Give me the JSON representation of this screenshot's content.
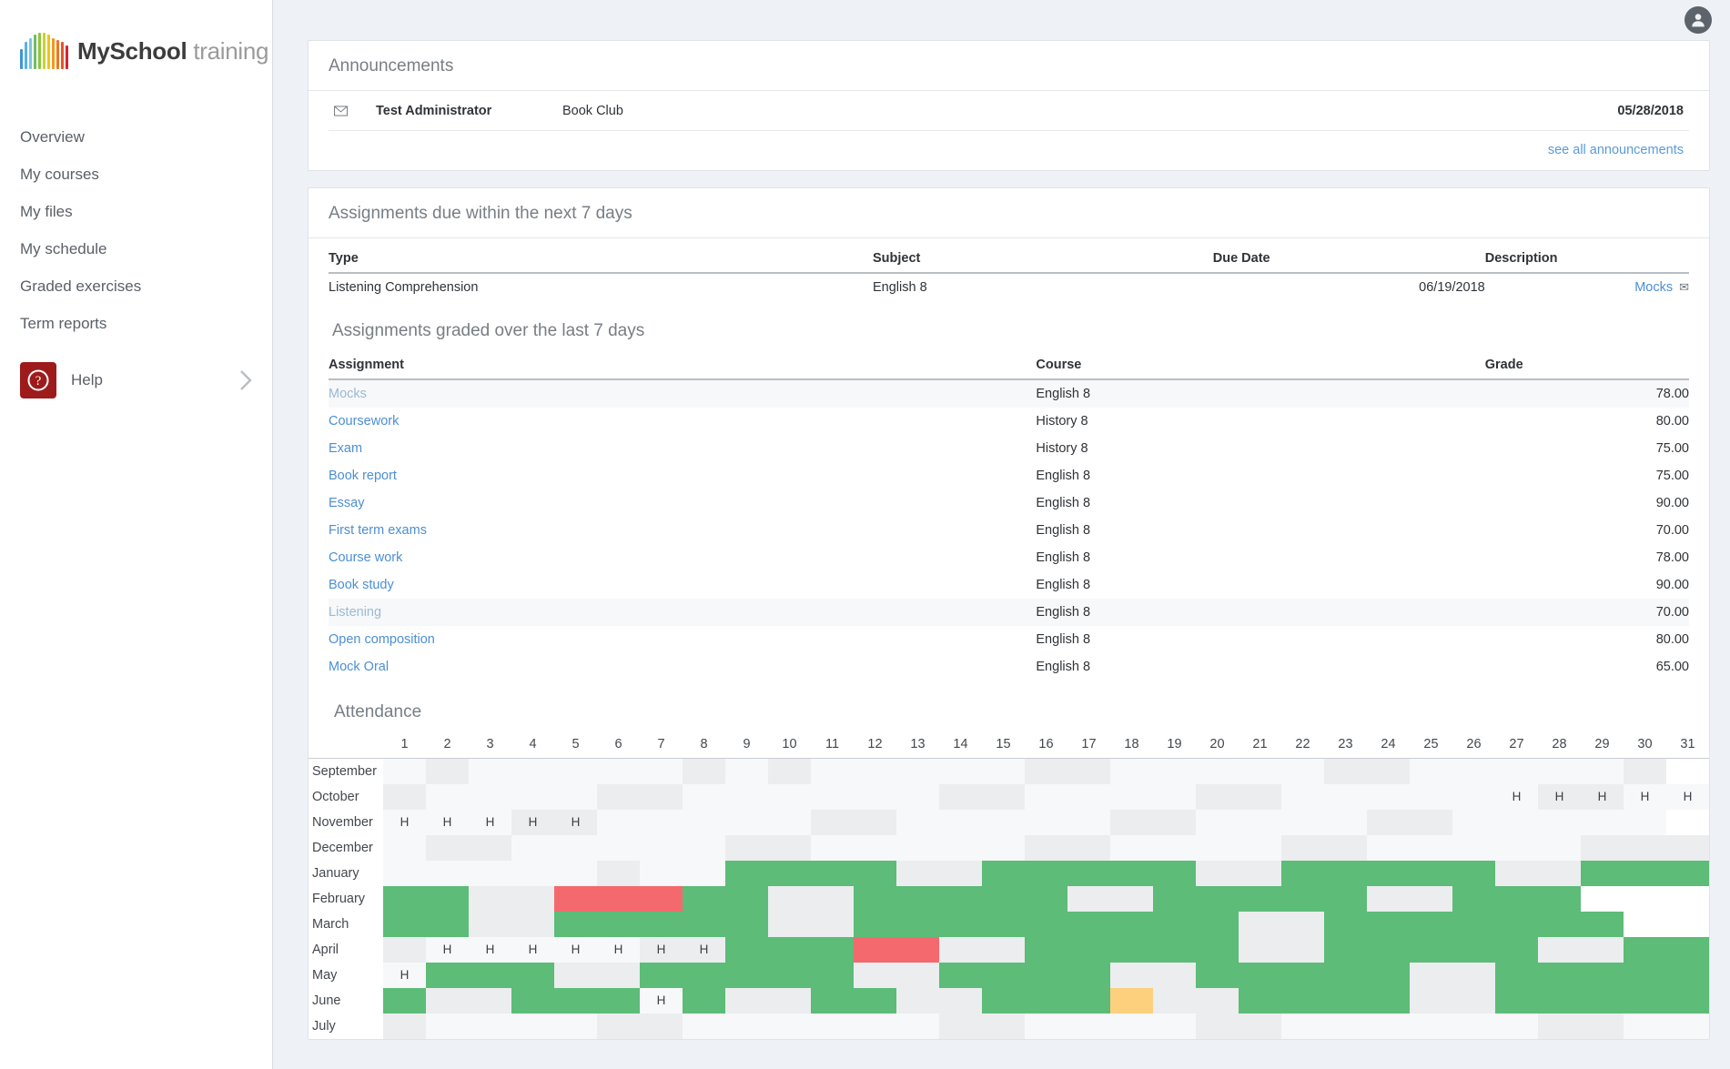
{
  "brand": {
    "name_bold": "MySchool",
    "name_light": " training",
    "bar_colors": [
      "#3d96d4",
      "#56b3e0",
      "#7ec3e8",
      "#6cbe63",
      "#8ec63f",
      "#c8d32f",
      "#f2c318",
      "#f59a1d",
      "#ef7622",
      "#e8532a",
      "#d8232a"
    ]
  },
  "sidebar": {
    "items": [
      {
        "label": "Overview"
      },
      {
        "label": "My courses"
      },
      {
        "label": "My files"
      },
      {
        "label": "My schedule"
      },
      {
        "label": "Graded exercises"
      },
      {
        "label": "Term reports"
      }
    ],
    "help": {
      "label": "Help",
      "icon": "question-mark-circle-icon",
      "color": "#9e1b1b"
    }
  },
  "topbar": {
    "avatar_icon": "user-avatar-icon"
  },
  "announcements": {
    "title": "Announcements",
    "row": {
      "icon": "envelope-icon",
      "from": "Test Administrator",
      "subject": "Book Club",
      "date": "05/28/2018"
    },
    "see_all": "see all announcements"
  },
  "assignments_due": {
    "title": "Assignments due within the next 7 days",
    "columns": [
      "Type",
      "Subject",
      "Due Date",
      "Description"
    ],
    "rows": [
      {
        "type": "Listening Comprehension",
        "subject": "English 8",
        "due_date": "06/19/2018",
        "description": "Mocks",
        "description_icon": "envelope-icon"
      }
    ]
  },
  "assignments_graded": {
    "title": "Assignments graded over the last 7 days",
    "columns": [
      "Assignment",
      "Course",
      "Grade"
    ],
    "rows": [
      {
        "assignment": "Mocks",
        "course": "English 8",
        "grade": "78.00",
        "highlight": true
      },
      {
        "assignment": "Coursework",
        "course": "History 8",
        "grade": "80.00",
        "highlight": false
      },
      {
        "assignment": "Exam",
        "course": "History 8",
        "grade": "75.00",
        "highlight": false
      },
      {
        "assignment": "Book report",
        "course": "English 8",
        "grade": "75.00",
        "highlight": false
      },
      {
        "assignment": "Essay",
        "course": "English 8",
        "grade": "90.00",
        "highlight": false
      },
      {
        "assignment": "First term exams",
        "course": "English 8",
        "grade": "70.00",
        "highlight": false
      },
      {
        "assignment": "Course work",
        "course": "English 8",
        "grade": "78.00",
        "highlight": false
      },
      {
        "assignment": "Book study",
        "course": "English 8",
        "grade": "90.00",
        "highlight": false
      },
      {
        "assignment": "Listening",
        "course": "English 8",
        "grade": "70.00",
        "highlight": true
      },
      {
        "assignment": "Open composition",
        "course": "English 8",
        "grade": "80.00",
        "highlight": false
      },
      {
        "assignment": "Mock Oral",
        "course": "English 8",
        "grade": "65.00",
        "highlight": false
      }
    ]
  },
  "attendance": {
    "title": "Attendance",
    "days": [
      1,
      2,
      3,
      4,
      5,
      6,
      7,
      8,
      9,
      10,
      11,
      12,
      13,
      14,
      15,
      16,
      17,
      18,
      19,
      20,
      21,
      22,
      23,
      24,
      25,
      26,
      27,
      28,
      29,
      30,
      31
    ],
    "legend": {
      "present": "#5cbc78",
      "absent": "#f4696d",
      "late": "#fdd07e",
      "holiday_label": "H"
    },
    "months": [
      {
        "name": "September",
        "cells": [
          "e1",
          "e2",
          "e1",
          "e1",
          "e1",
          "e1",
          "e1",
          "e2",
          "e1",
          "e2",
          "e1",
          "e1",
          "e1",
          "e1",
          "e1",
          "e2",
          "e2",
          "e1",
          "e1",
          "e1",
          "e1",
          "e1",
          "e2",
          "e2",
          "e1",
          "e1",
          "e1",
          "e1",
          "e1",
          "e2",
          "e0"
        ]
      },
      {
        "name": "October",
        "cells": [
          "e2",
          "e1",
          "e1",
          "e1",
          "e1",
          "e2",
          "e2",
          "e1",
          "e1",
          "e1",
          "e1",
          "e1",
          "e1",
          "e2",
          "e2",
          "e1",
          "e1",
          "e1",
          "e1",
          "e2",
          "e2",
          "e1",
          "e1",
          "e1",
          "e1",
          "e1",
          "e1",
          "e2",
          "e2",
          "e1",
          "e1"
        ],
        "labels": {
          "27": "H",
          "28": "H",
          "29": "H",
          "30": "H",
          "31": "H"
        }
      },
      {
        "name": "November",
        "cells": [
          "e1",
          "e1",
          "e1",
          "e2",
          "e2",
          "e1",
          "e1",
          "e1",
          "e1",
          "e1",
          "e2",
          "e2",
          "e1",
          "e1",
          "e1",
          "e1",
          "e1",
          "e2",
          "e2",
          "e1",
          "e1",
          "e1",
          "e1",
          "e2",
          "e2",
          "e1",
          "e1",
          "e1",
          "e1",
          "e1",
          "e0"
        ],
        "labels": {
          "1": "H",
          "2": "H",
          "3": "H",
          "4": "H",
          "5": "H"
        }
      },
      {
        "name": "December",
        "cells": [
          "e1",
          "e2",
          "e2",
          "e1",
          "e1",
          "e1",
          "e1",
          "e1",
          "e2",
          "e2",
          "e1",
          "e1",
          "e1",
          "e1",
          "e1",
          "e2",
          "e2",
          "e1",
          "e1",
          "e1",
          "e1",
          "e2",
          "e2",
          "e1",
          "e1",
          "e1",
          "e1",
          "e1",
          "e2",
          "e2",
          "e2"
        ]
      },
      {
        "name": "January",
        "cells": [
          "e1",
          "e1",
          "e1",
          "e1",
          "e1",
          "e2",
          "e1",
          "e1",
          "g",
          "g",
          "g",
          "g",
          "e2",
          "e2",
          "g",
          "g",
          "g",
          "g",
          "g",
          "e2",
          "e2",
          "g",
          "g",
          "g",
          "g",
          "g",
          "e2",
          "e2",
          "g",
          "g",
          "g"
        ]
      },
      {
        "name": "February",
        "cells": [
          "g",
          "g",
          "e2",
          "e2",
          "r",
          "r",
          "r",
          "g",
          "g",
          "e2",
          "e2",
          "g",
          "g",
          "g",
          "g",
          "g",
          "e2",
          "e2",
          "g",
          "g",
          "g",
          "g",
          "g",
          "e2",
          "e2",
          "g",
          "g",
          "g",
          "e0",
          "e0",
          "e0"
        ]
      },
      {
        "name": "March",
        "cells": [
          "g",
          "g",
          "e2",
          "e2",
          "g",
          "g",
          "g",
          "g",
          "g",
          "e2",
          "e2",
          "g",
          "g",
          "g",
          "g",
          "g",
          "g",
          "g",
          "g",
          "g",
          "e2",
          "e2",
          "g",
          "g",
          "g",
          "g",
          "g",
          "g",
          "g",
          "e0",
          "e0"
        ]
      },
      {
        "name": "April",
        "cells": [
          "e2",
          "e1",
          "e1",
          "e1",
          "e1",
          "e1",
          "e2",
          "e2",
          "g",
          "g",
          "g",
          "r",
          "r",
          "e2",
          "e2",
          "g",
          "g",
          "g",
          "g",
          "g",
          "e2",
          "e2",
          "g",
          "g",
          "g",
          "g",
          "g",
          "e2",
          "e2",
          "g",
          "g"
        ],
        "labels": {
          "2": "H",
          "3": "H",
          "4": "H",
          "5": "H",
          "6": "H",
          "7": "H",
          "8": "H"
        }
      },
      {
        "name": "May",
        "cells": [
          "e1",
          "g",
          "g",
          "g",
          "e2",
          "e2",
          "g",
          "g",
          "g",
          "g",
          "g",
          "e2",
          "e2",
          "g",
          "g",
          "g",
          "g",
          "e2",
          "e2",
          "g",
          "g",
          "g",
          "g",
          "g",
          "e2",
          "e2",
          "g",
          "g",
          "g",
          "g",
          "g"
        ],
        "labels": {
          "1": "H"
        }
      },
      {
        "name": "June",
        "cells": [
          "g",
          "e2",
          "e2",
          "g",
          "g",
          "g",
          "e1",
          "g",
          "e2",
          "e2",
          "g",
          "g",
          "e2",
          "e2",
          "g",
          "g",
          "g",
          "o",
          "e2",
          "e2",
          "g",
          "g",
          "g",
          "g",
          "e2",
          "e2",
          "g",
          "g",
          "g",
          "g",
          "g"
        ],
        "labels": {
          "7": "H"
        }
      },
      {
        "name": "July",
        "cells": [
          "e2",
          "e1",
          "e1",
          "e1",
          "e1",
          "e2",
          "e2",
          "e1",
          "e1",
          "e1",
          "e1",
          "e1",
          "e1",
          "e2",
          "e2",
          "e1",
          "e1",
          "e1",
          "e1",
          "e2",
          "e2",
          "e1",
          "e1",
          "e1",
          "e1",
          "e1",
          "e1",
          "e2",
          "e2",
          "e1",
          "e1"
        ]
      }
    ]
  }
}
